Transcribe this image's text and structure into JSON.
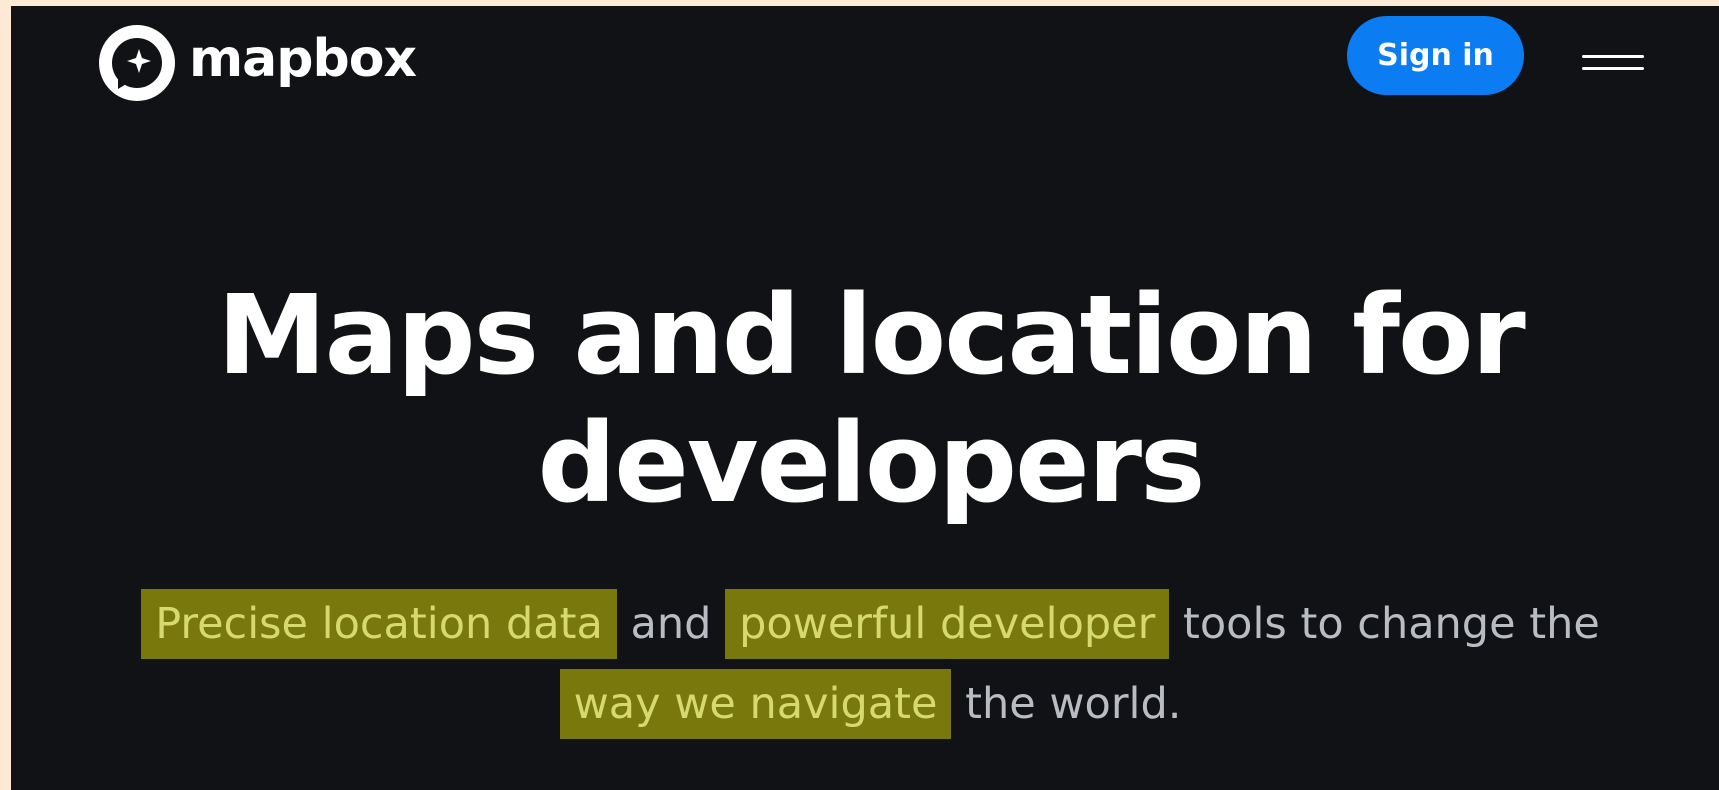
{
  "brand": {
    "name": "mapbox",
    "logo_icon": "mapbox-sparkle-icon",
    "accent_color": "#0b7cf2",
    "background_color": "#101215",
    "highlight_color": "#78780c"
  },
  "nav": {
    "signin_label": "Sign in",
    "menu_icon": "hamburger-menu-icon"
  },
  "hero": {
    "title_line1": "Maps and location for",
    "title_line2": "developers",
    "subtitle": {
      "part1": "Precise location data",
      "part2": " and ",
      "part3": "powerful developer",
      "part4": " tools to change the",
      "part5": "way we navigate",
      "part6": " the world."
    }
  }
}
